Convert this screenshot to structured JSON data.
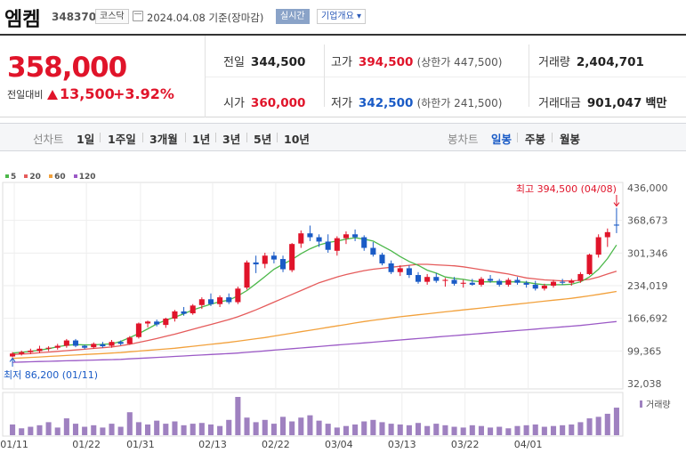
{
  "header": {
    "name": "엠켐",
    "code": "348370",
    "market": "코스닥",
    "date": "2024.04.08 기준(장마감)",
    "live": "실시간",
    "corp": "기업개요 ▾"
  },
  "quote": {
    "price": "358,000",
    "change_label": "전일대비",
    "change": "13,500",
    "change_pct": "+3.92%",
    "prev_label": "전일",
    "prev": "344,500",
    "high_label": "고가",
    "high": "394,500",
    "upper_limit": "(상한가 447,500)",
    "volume_label": "거래량",
    "volume": "2,404,701",
    "open_label": "시가",
    "open": "360,000",
    "low_label": "저가",
    "low": "342,500",
    "lower_limit": "(하한가 241,500)",
    "amount_label": "거래대금",
    "amount": "901,047",
    "amount_unit": "백만"
  },
  "tabs": {
    "line": "선차트",
    "periods": [
      "1일",
      "1주일",
      "3개월",
      "1년",
      "3년",
      "5년",
      "10년"
    ],
    "candle": "봉차트",
    "candle_periods": [
      "일봉",
      "주봉",
      "월봉"
    ],
    "candle_selected": "일봉"
  },
  "colors": {
    "up": "#e0142a",
    "down": "#1a5bc6",
    "ma5": "#4cb84a",
    "ma20": "#e55b5b",
    "ma60": "#f2a13c",
    "ma120": "#9b59c6",
    "volume": "#9f81c0"
  },
  "chart_data": {
    "type": "candlestick",
    "legend": [
      "5",
      "20",
      "60",
      "120"
    ],
    "ylim": [
      32038,
      436000
    ],
    "y_ticks": [
      "436,000",
      "368,673",
      "301,346",
      "234,019",
      "166,692",
      "99,365",
      "32,038"
    ],
    "x_ticks": [
      "01/11",
      "01/22",
      "01/31",
      "02/13",
      "02/22",
      "03/04",
      "03/13",
      "03/22",
      "04/01"
    ],
    "volume_label": "거래량",
    "max_annotation": "최고 394,500 (04/08)",
    "min_annotation": "최저 86,200 (01/11)",
    "candles": [
      {
        "o": 88000,
        "h": 97000,
        "l": 86200,
        "c": 94000
      },
      {
        "o": 93000,
        "h": 100000,
        "l": 90000,
        "c": 97000
      },
      {
        "o": 97000,
        "h": 104000,
        "l": 93000,
        "c": 100000
      },
      {
        "o": 99000,
        "h": 110000,
        "l": 95000,
        "c": 104000
      },
      {
        "o": 104000,
        "h": 109000,
        "l": 99000,
        "c": 106000
      },
      {
        "o": 106000,
        "h": 114000,
        "l": 102000,
        "c": 110000
      },
      {
        "o": 110000,
        "h": 124000,
        "l": 106000,
        "c": 121000
      },
      {
        "o": 121000,
        "h": 124000,
        "l": 107000,
        "c": 110000
      },
      {
        "o": 110000,
        "h": 112000,
        "l": 103000,
        "c": 106000
      },
      {
        "o": 107000,
        "h": 117000,
        "l": 104000,
        "c": 114000
      },
      {
        "o": 113000,
        "h": 118000,
        "l": 106000,
        "c": 109000
      },
      {
        "o": 110000,
        "h": 122000,
        "l": 106000,
        "c": 118000
      },
      {
        "o": 118000,
        "h": 121000,
        "l": 111000,
        "c": 114000
      },
      {
        "o": 114000,
        "h": 130000,
        "l": 112000,
        "c": 127000
      },
      {
        "o": 128000,
        "h": 158000,
        "l": 125000,
        "c": 156000
      },
      {
        "o": 156000,
        "h": 162000,
        "l": 148000,
        "c": 160000
      },
      {
        "o": 160000,
        "h": 164000,
        "l": 150000,
        "c": 154000
      },
      {
        "o": 153000,
        "h": 168000,
        "l": 147000,
        "c": 166000
      },
      {
        "o": 166000,
        "h": 184000,
        "l": 160000,
        "c": 181000
      },
      {
        "o": 181000,
        "h": 190000,
        "l": 172000,
        "c": 176000
      },
      {
        "o": 177000,
        "h": 196000,
        "l": 174000,
        "c": 193000
      },
      {
        "o": 194000,
        "h": 210000,
        "l": 186000,
        "c": 206000
      },
      {
        "o": 206000,
        "h": 218000,
        "l": 192000,
        "c": 196000
      },
      {
        "o": 196000,
        "h": 214000,
        "l": 190000,
        "c": 210000
      },
      {
        "o": 210000,
        "h": 218000,
        "l": 196000,
        "c": 200000
      },
      {
        "o": 200000,
        "h": 232000,
        "l": 196000,
        "c": 228000
      },
      {
        "o": 230000,
        "h": 286000,
        "l": 226000,
        "c": 282000
      },
      {
        "o": 282000,
        "h": 296000,
        "l": 260000,
        "c": 278000
      },
      {
        "o": 279000,
        "h": 302000,
        "l": 270000,
        "c": 296000
      },
      {
        "o": 296000,
        "h": 304000,
        "l": 280000,
        "c": 288000
      },
      {
        "o": 289000,
        "h": 296000,
        "l": 262000,
        "c": 268000
      },
      {
        "o": 266000,
        "h": 322000,
        "l": 262000,
        "c": 320000
      },
      {
        "o": 321000,
        "h": 348000,
        "l": 312000,
        "c": 342000
      },
      {
        "o": 342000,
        "h": 358000,
        "l": 326000,
        "c": 334000
      },
      {
        "o": 334000,
        "h": 340000,
        "l": 314000,
        "c": 325000
      },
      {
        "o": 325000,
        "h": 340000,
        "l": 302000,
        "c": 308000
      },
      {
        "o": 306000,
        "h": 336000,
        "l": 296000,
        "c": 332000
      },
      {
        "o": 332000,
        "h": 346000,
        "l": 320000,
        "c": 340000
      },
      {
        "o": 340000,
        "h": 350000,
        "l": 326000,
        "c": 334000
      },
      {
        "o": 334000,
        "h": 338000,
        "l": 306000,
        "c": 312000
      },
      {
        "o": 312000,
        "h": 324000,
        "l": 294000,
        "c": 298000
      },
      {
        "o": 298000,
        "h": 302000,
        "l": 276000,
        "c": 280000
      },
      {
        "o": 280000,
        "h": 286000,
        "l": 258000,
        "c": 262000
      },
      {
        "o": 262000,
        "h": 276000,
        "l": 254000,
        "c": 270000
      },
      {
        "o": 270000,
        "h": 276000,
        "l": 250000,
        "c": 256000
      },
      {
        "o": 256000,
        "h": 262000,
        "l": 238000,
        "c": 242000
      },
      {
        "o": 242000,
        "h": 258000,
        "l": 236000,
        "c": 252000
      },
      {
        "o": 252000,
        "h": 260000,
        "l": 240000,
        "c": 244000
      },
      {
        "o": 244000,
        "h": 250000,
        "l": 232000,
        "c": 246000
      },
      {
        "o": 246000,
        "h": 252000,
        "l": 234000,
        "c": 238000
      },
      {
        "o": 238000,
        "h": 246000,
        "l": 230000,
        "c": 240000
      },
      {
        "o": 240000,
        "h": 248000,
        "l": 234000,
        "c": 236000
      },
      {
        "o": 236000,
        "h": 252000,
        "l": 232000,
        "c": 248000
      },
      {
        "o": 248000,
        "h": 256000,
        "l": 240000,
        "c": 244000
      },
      {
        "o": 244000,
        "h": 248000,
        "l": 232000,
        "c": 236000
      },
      {
        "o": 236000,
        "h": 250000,
        "l": 232000,
        "c": 246000
      },
      {
        "o": 246000,
        "h": 252000,
        "l": 236000,
        "c": 240000
      },
      {
        "o": 240000,
        "h": 244000,
        "l": 230000,
        "c": 236000
      },
      {
        "o": 236000,
        "h": 244000,
        "l": 224000,
        "c": 228000
      },
      {
        "o": 228000,
        "h": 238000,
        "l": 224000,
        "c": 234000
      },
      {
        "o": 234000,
        "h": 246000,
        "l": 230000,
        "c": 242000
      },
      {
        "o": 242000,
        "h": 248000,
        "l": 236000,
        "c": 240000
      },
      {
        "o": 240000,
        "h": 248000,
        "l": 234000,
        "c": 244000
      },
      {
        "o": 244000,
        "h": 262000,
        "l": 240000,
        "c": 258000
      },
      {
        "o": 258000,
        "h": 300000,
        "l": 256000,
        "c": 298000
      },
      {
        "o": 298000,
        "h": 340000,
        "l": 292000,
        "c": 334000
      },
      {
        "o": 334000,
        "h": 352000,
        "l": 314000,
        "c": 344500
      },
      {
        "o": 360000,
        "h": 394500,
        "l": 342500,
        "c": 358000
      }
    ],
    "volume": [
      28,
      18,
      22,
      26,
      34,
      20,
      44,
      30,
      22,
      26,
      20,
      30,
      22,
      60,
      34,
      28,
      38,
      30,
      36,
      26,
      30,
      32,
      28,
      24,
      40,
      100,
      46,
      34,
      40,
      30,
      48,
      36,
      46,
      52,
      38,
      30,
      20,
      24,
      28,
      36,
      40,
      34,
      30,
      28,
      26,
      32,
      24,
      30,
      26,
      22,
      20,
      26,
      24,
      20,
      22,
      18,
      24,
      26,
      28,
      22,
      24,
      26,
      28,
      34,
      44,
      48,
      56,
      72
    ],
    "ma5": [
      95000,
      96500,
      98500,
      101000,
      104000,
      108000,
      111000,
      112500,
      112000,
      112000,
      113000,
      114000,
      119000,
      127000,
      135000,
      145000,
      155000,
      163000,
      169000,
      176000,
      184000,
      190000,
      196000,
      201000,
      204000,
      213000,
      224000,
      238000,
      253000,
      268000,
      278000,
      288000,
      300000,
      310000,
      318000,
      323000,
      326000,
      330000,
      333000,
      330000,
      326000,
      316000,
      306000,
      294000,
      284000,
      276000,
      266000,
      260000,
      252000,
      249000,
      247000,
      244000,
      242000,
      242000,
      242000,
      242000,
      242000,
      241000,
      238000,
      236000,
      236000,
      236000,
      237000,
      242000,
      252000,
      268000,
      290000,
      318000
    ],
    "ma20": [
      92000,
      93000,
      94000,
      95500,
      97000,
      98500,
      100000,
      101500,
      103000,
      104500,
      106000,
      107500,
      110000,
      113000,
      117000,
      121000,
      125000,
      129500,
      134000,
      139000,
      144000,
      149000,
      154000,
      159000,
      164000,
      170000,
      177000,
      184000,
      192000,
      200000,
      208000,
      216000,
      224000,
      232000,
      240000,
      246000,
      252000,
      257000,
      261000,
      265000,
      268000,
      270000,
      272000,
      274000,
      276000,
      278000,
      278000,
      277000,
      276000,
      275000,
      273000,
      270000,
      267000,
      264000,
      261000,
      258000,
      254000,
      250000,
      248000,
      246000,
      245000,
      244000,
      244000,
      245000,
      247000,
      252000,
      258000,
      264000
    ],
    "ma60": [
      84000,
      85000,
      86000,
      87000,
      88000,
      89000,
      90000,
      91000,
      92000,
      93000,
      94000,
      95000,
      96000,
      97500,
      99000,
      100500,
      102000,
      103500,
      105000,
      107000,
      109000,
      111000,
      113000,
      115000,
      117000,
      119500,
      122000,
      124500,
      127000,
      130000,
      133000,
      136000,
      139000,
      142000,
      145000,
      148000,
      151000,
      154000,
      157000,
      160000,
      162500,
      165000,
      167500,
      170000,
      172000,
      174000,
      176000,
      178000,
      180000,
      182000,
      184000,
      186000,
      188000,
      190000,
      192000,
      194000,
      196000,
      198000,
      200000,
      202000,
      204000,
      206000,
      208000,
      210500,
      213000,
      216000,
      219000,
      222000
    ],
    "ma120": [
      76000,
      76500,
      77000,
      77500,
      78000,
      78500,
      79000,
      79500,
      80000,
      80500,
      81000,
      81500,
      82000,
      83000,
      84000,
      85000,
      86000,
      87000,
      88000,
      89000,
      90000,
      91000,
      92000,
      93000,
      94000,
      95000,
      96500,
      98000,
      99500,
      101000,
      102500,
      104000,
      105500,
      107000,
      108500,
      110000,
      111500,
      113000,
      114500,
      116000,
      117500,
      119000,
      120500,
      122000,
      123500,
      125000,
      126500,
      128000,
      129500,
      131000,
      132500,
      134000,
      135500,
      137000,
      138500,
      140000,
      141500,
      143000,
      144500,
      146000,
      147500,
      149000,
      150500,
      152000,
      154000,
      156000,
      158000,
      160000
    ]
  }
}
